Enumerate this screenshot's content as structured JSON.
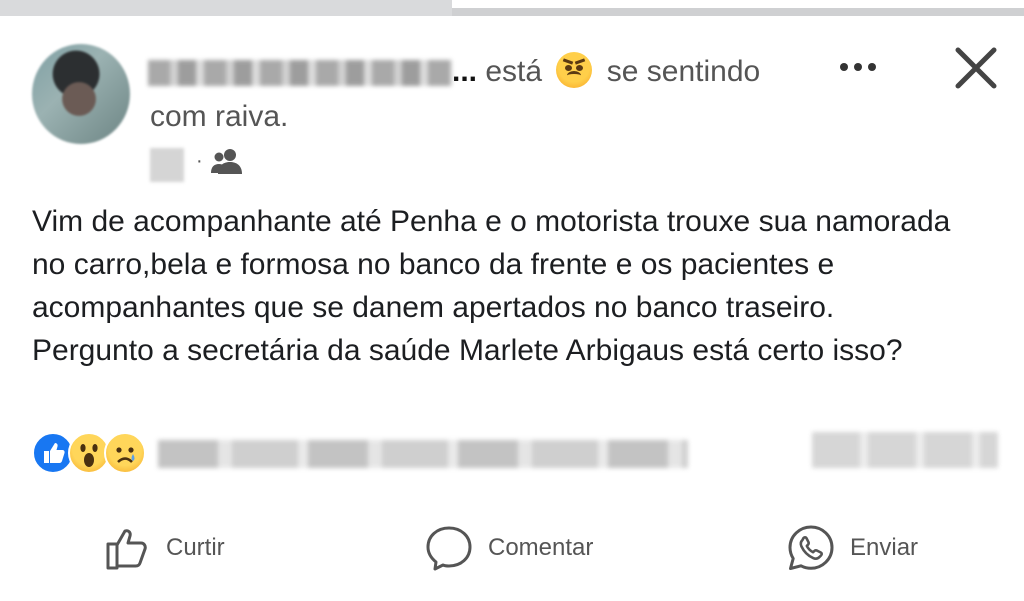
{
  "post": {
    "author": {
      "name_visible": "...",
      "feeling_prefix": "está",
      "feeling_suffix": "se sentindo",
      "feeling": "com raiva.",
      "feeling_icon": "angry-face-emoji"
    },
    "meta": {
      "separator": "·",
      "audience_icon": "friends-icon"
    },
    "header_actions": {
      "more_icon": "more-options-icon",
      "close_icon": "close-icon"
    },
    "body": [
      "Vim de acompanhante até Penha e o motorista trouxe sua namorada no carro,bela e formosa no banco da frente e os pacientes e acompanhantes que se danem  apertados no banco traseiro.",
      "Pergunto a secretária da saúde Marlete Arbigaus está certo isso?"
    ],
    "reactions": {
      "icons": [
        "like-reaction-icon",
        "wow-reaction-icon",
        "sad-reaction-icon"
      ]
    },
    "actions": [
      {
        "label": "Curtir",
        "icon": "thumbs-up-icon"
      },
      {
        "label": "Comentar",
        "icon": "comment-icon"
      },
      {
        "label": "Enviar",
        "icon": "whatsapp-icon"
      }
    ]
  },
  "colors": {
    "like_blue": "#1877f2",
    "text_primary": "#1c1e21",
    "text_secondary": "#555555"
  }
}
